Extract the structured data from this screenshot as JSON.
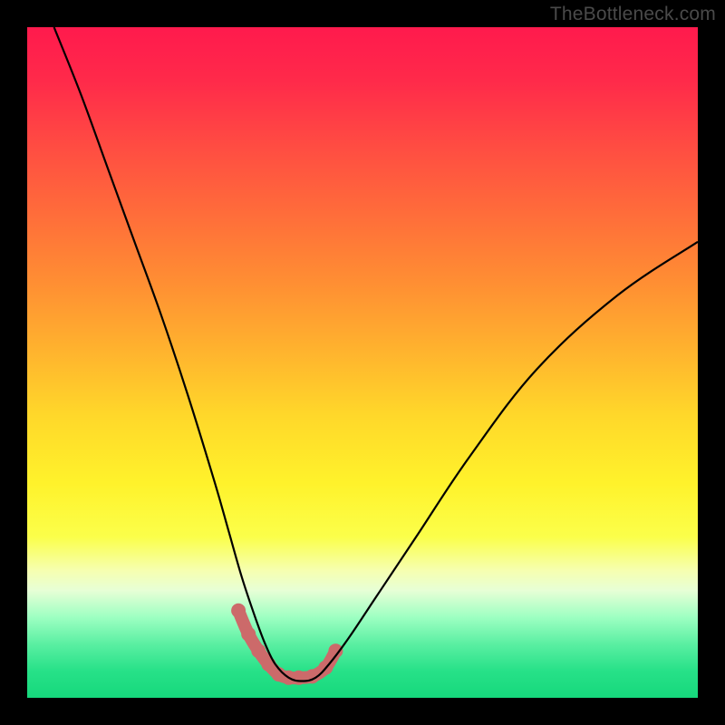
{
  "watermark": "TheBottleneck.com",
  "colors": {
    "curve": "#000000",
    "marker": "#cc6a6a",
    "gradient_top": "#ff1a4d",
    "gradient_bottom": "#16d87c",
    "frame": "#000000"
  },
  "chart_data": {
    "type": "line",
    "title": "",
    "xlabel": "",
    "ylabel": "",
    "xlim": [
      0,
      100
    ],
    "ylim": [
      0,
      100
    ],
    "legend": false,
    "grid": false,
    "annotations": [],
    "series": [
      {
        "name": "bottleneck-curve",
        "x": [
          4,
          8,
          12,
          16,
          20,
          24,
          28,
          30,
          32,
          34,
          35.5,
          37,
          39,
          41,
          43,
          45,
          48,
          52,
          58,
          66,
          76,
          88,
          100
        ],
        "values": [
          100,
          90,
          79,
          68,
          57,
          45,
          32,
          25,
          18,
          12,
          8,
          5,
          3,
          2.5,
          3,
          5,
          9,
          15,
          24,
          36,
          49,
          60,
          68
        ]
      }
    ],
    "markers": {
      "name": "highlight-points",
      "x": [
        31.5,
        33,
        34.5,
        36,
        37.5,
        39,
        40.5,
        42.5,
        44.5,
        46
      ],
      "values": [
        13,
        9.5,
        7,
        5,
        3.5,
        3,
        3,
        3.2,
        4.5,
        7
      ]
    }
  }
}
